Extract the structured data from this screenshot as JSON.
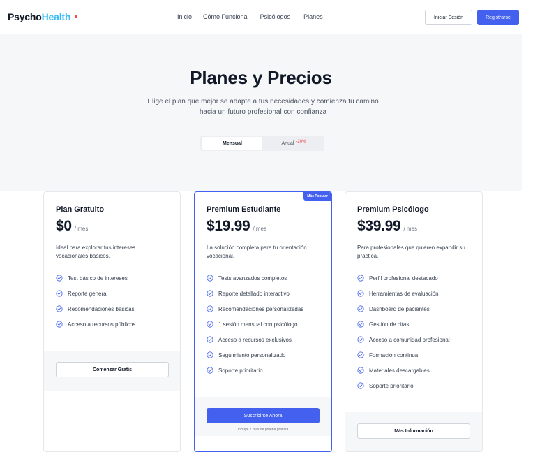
{
  "brand": {
    "part1": "Psycho",
    "part2": "Health"
  },
  "nav": {
    "links": [
      "Inicio",
      "Cómo Funciona",
      "Psicólogos",
      "Planes"
    ],
    "login": "Iniciar Sesión",
    "register": "Registrarse"
  },
  "hero": {
    "title": "Planes y Precios",
    "subtitle": "Elige el plan que mejor se adapte a tus necesidades y comienza tu camino hacia un futuro profesional con confianza",
    "toggle": {
      "monthly": "Mensual",
      "annual": "Anual",
      "discount": "-20%"
    }
  },
  "colors": {
    "accent": "#4361ee",
    "brand_light": "#38bdf8",
    "discount": "#ef4444",
    "hero_bg": "#f6f7f9"
  },
  "plans": [
    {
      "name": "Plan Gratuito",
      "price": "$0",
      "period": "/ mes",
      "description": "Ideal para explorar tus intereses vocacionales básicos.",
      "features": [
        "Test básico de intereses",
        "Reporte general",
        "Recomendaciones básicas",
        "Acceso a recursos públicos"
      ],
      "cta": "Comenzar Gratis"
    },
    {
      "name": "Premium Estudiante",
      "badge": "Más Popular",
      "price": "$19.99",
      "period": "/ mes",
      "description": "La solución completa para tu orientación vocacional.",
      "features": [
        "Tests avanzados completos",
        "Reporte detallado interactivo",
        "Recomendaciones personalizadas",
        "1 sesión mensual con psicólogo",
        "Acceso a recursos exclusivos",
        "Seguimiento personalizado",
        "Soporte prioritario"
      ],
      "cta": "Suscribirse Ahora",
      "note": "Incluye 7 días de prueba gratuita"
    },
    {
      "name": "Premium Psicólogo",
      "price": "$39.99",
      "period": "/ mes",
      "description": "Para profesionales que quieren expandir su práctica.",
      "features": [
        "Perfil profesional destacado",
        "Herramientas de evaluación",
        "Dashboard de pacientes",
        "Gestión de citas",
        "Acceso a comunidad profesional",
        "Formación continua",
        "Materiales descargables",
        "Soporte prioritario"
      ],
      "cta": "Más Información"
    }
  ],
  "icons": {
    "feature": "check-circle-icon"
  }
}
